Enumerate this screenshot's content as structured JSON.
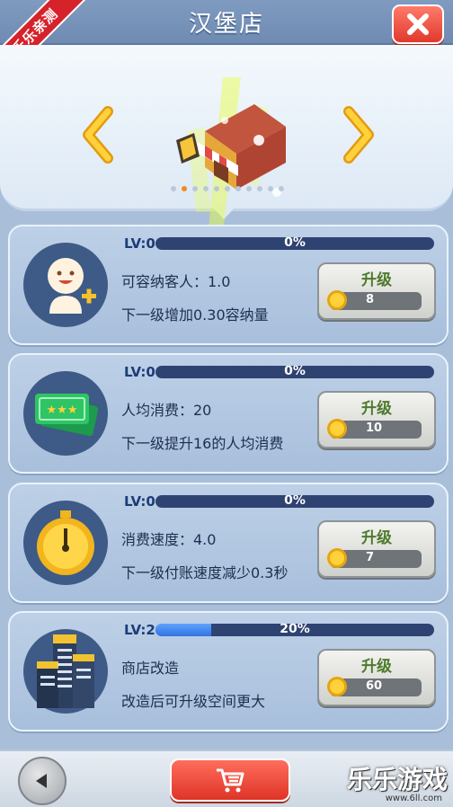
{
  "header": {
    "title": "汉堡店",
    "ribbon": "乐乐亲测"
  },
  "carousel": {
    "page_count": 11,
    "active_index": 1
  },
  "upgrades": [
    {
      "level": "LV:0",
      "progress_text": "0%",
      "progress": 0,
      "line1": "可容纳客人：1.0",
      "line2": "下一级增加0.30容纳量",
      "button_label": "升级",
      "cost": "8",
      "icon": "customer-icon"
    },
    {
      "level": "LV:0",
      "progress_text": "0%",
      "progress": 0,
      "line1": "人均消费：20",
      "line2": "下一级提升16的人均消费",
      "button_label": "升级",
      "cost": "10",
      "icon": "ticket-icon"
    },
    {
      "level": "LV:0",
      "progress_text": "0%",
      "progress": 0,
      "line1": "消费速度：4.0",
      "line2": "下一级付账速度减少0.3秒",
      "button_label": "升级",
      "cost": "7",
      "icon": "stopwatch-icon"
    },
    {
      "level": "LV:2",
      "progress_text": "20%",
      "progress": 0.2,
      "line1": "商店改造",
      "line2": "改造后可升级空间更大",
      "button_label": "升级",
      "cost": "60",
      "icon": "buildings-icon"
    }
  ],
  "footer": {
    "watermark": "乐乐游戏",
    "watermark_url": "www.6ll.com"
  }
}
